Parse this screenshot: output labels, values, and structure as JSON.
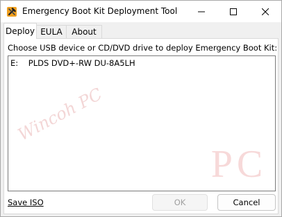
{
  "window": {
    "title": "Emergency Boot Kit Deployment Tool",
    "icon": "hammer-wrench-icon"
  },
  "tabs": [
    {
      "label": "Deploy",
      "active": true
    },
    {
      "label": "EULA",
      "active": false
    },
    {
      "label": "About",
      "active": false
    }
  ],
  "deploy": {
    "prompt": "Choose USB device or CD/DVD drive to deploy Emergency Boot Kit:",
    "devices": [
      {
        "label": "E:    PLDS DVD+-RW DU-8A5LH",
        "selected": false
      }
    ],
    "watermark_text": "Wincoh PC",
    "pc_mark": "PC"
  },
  "footer": {
    "save_iso_label": "Save ISO",
    "ok_label": "OK",
    "ok_enabled": false,
    "cancel_label": "Cancel"
  }
}
